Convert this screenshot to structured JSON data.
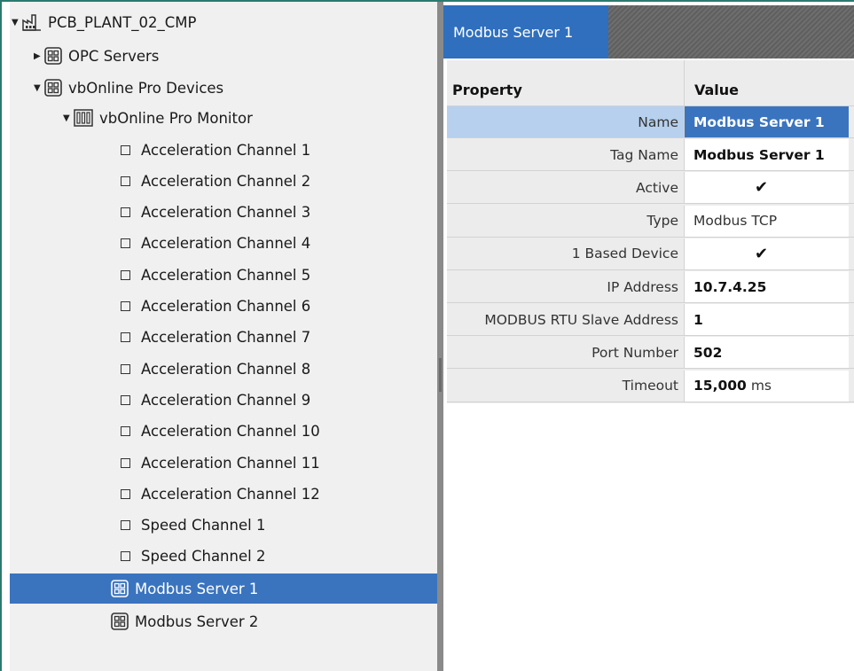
{
  "tree": {
    "root": {
      "label": "PCB_PLANT_02_CMP",
      "icon": "factory-icon"
    },
    "opc": {
      "label": "OPC Servers",
      "icon": "grid-icon"
    },
    "devices": {
      "label": "vbOnline Pro Devices",
      "icon": "grid-icon"
    },
    "monitor": {
      "label": "vbOnline Pro Monitor",
      "icon": "rack-icon"
    },
    "channels": [
      "Acceleration Channel 1",
      "Acceleration Channel 2",
      "Acceleration Channel 3",
      "Acceleration Channel 4",
      "Acceleration Channel 5",
      "Acceleration Channel 6",
      "Acceleration Channel 7",
      "Acceleration Channel 8",
      "Acceleration Channel 9",
      "Acceleration Channel 10",
      "Acceleration Channel 11",
      "Acceleration Channel 12",
      "Speed Channel 1",
      "Speed Channel 2"
    ],
    "servers": [
      "Modbus Server 1",
      "Modbus Server 2"
    ],
    "selected": "Modbus Server 1"
  },
  "panel": {
    "tab": "Modbus Server 1",
    "columns": {
      "property": "Property",
      "value": "Value"
    },
    "rows": [
      {
        "property": "Name",
        "value": "Modbus Server 1",
        "bold": true
      },
      {
        "property": "Tag Name",
        "value": "Modbus Server 1",
        "bold": true
      },
      {
        "property": "Active",
        "value": "✔",
        "check": true
      },
      {
        "property": "Type",
        "value": "Modbus TCP"
      },
      {
        "property": "1 Based Device",
        "value": "✔",
        "check": true
      },
      {
        "property": "IP Address",
        "value": "10.7.4.25",
        "bold": true
      },
      {
        "property": "MODBUS RTU Slave Address",
        "value": "1",
        "bold": true
      },
      {
        "property": "Port Number",
        "value": "502",
        "bold": true
      },
      {
        "property": "Timeout",
        "value": "15,000",
        "bold": true,
        "unit": "ms"
      }
    ]
  },
  "colors": {
    "accent": "#3a74bf",
    "tab": "#2f6fbd",
    "selected_property": "#b6d0ee"
  }
}
